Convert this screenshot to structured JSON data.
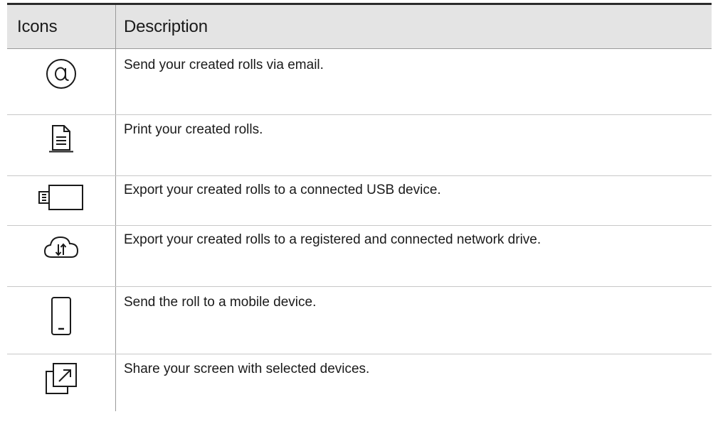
{
  "table": {
    "header": {
      "icons": "Icons",
      "description": "Description"
    },
    "rows": [
      {
        "icon": "email-at-icon",
        "description": "Send your created rolls via email."
      },
      {
        "icon": "document-print-icon",
        "description": "Print your created rolls."
      },
      {
        "icon": "usb-drive-icon",
        "description": "Export your created rolls to a connected USB device."
      },
      {
        "icon": "cloud-transfer-icon",
        "description": "Export your created rolls to a registered and connected network drive."
      },
      {
        "icon": "mobile-phone-icon",
        "description": "Send the roll to a mobile device."
      },
      {
        "icon": "screen-share-icon",
        "description": "Share your screen with selected devices."
      }
    ]
  },
  "colors": {
    "header_bg": "#e4e4e4",
    "top_rule": "#2b2b2b",
    "text": "#1a1a1a",
    "row_divider": "#c8c8c8"
  }
}
